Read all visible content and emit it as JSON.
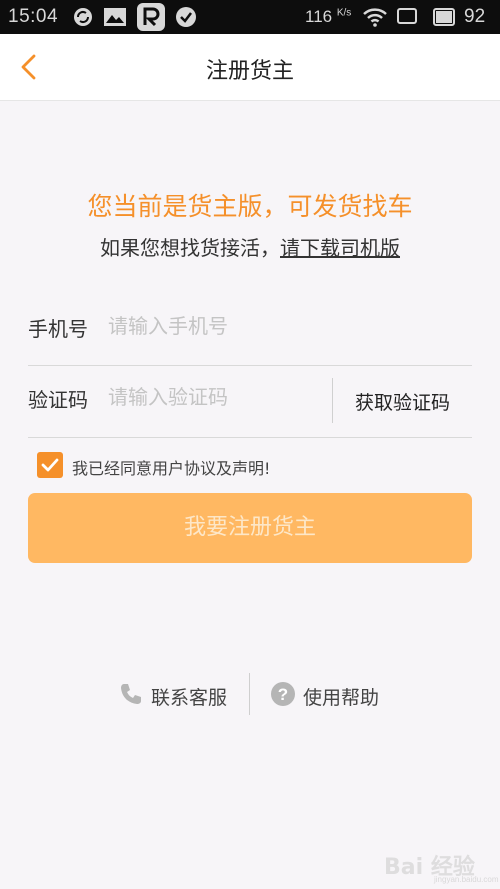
{
  "status_bar": {
    "time": "15:04",
    "network_speed": "116",
    "network_unit": "K/s",
    "battery": "92",
    "icons": [
      "sync-icon",
      "image-icon",
      "r-app-icon",
      "check-circle-icon",
      "wifi-icon",
      "battery-icon"
    ]
  },
  "header": {
    "title": "注册货主",
    "back_icon": "chevron-left-icon"
  },
  "intro": {
    "headline": "您当前是货主版，可发货找车",
    "subline_prefix": "如果您想找货接活，",
    "subline_link": "请下载司机版"
  },
  "form": {
    "phone": {
      "label": "手机号",
      "value": "",
      "placeholder": "请输入手机号"
    },
    "code": {
      "label": "验证码",
      "value": "",
      "placeholder": "请输入验证码"
    },
    "get_code_label": "获取验证码"
  },
  "agreement": {
    "checked": true,
    "text": "我已经同意用户协议及声明!"
  },
  "register_button": {
    "label": "我要注册货主"
  },
  "bottom_links": {
    "contact": {
      "label": "联系客服",
      "icon": "phone-icon"
    },
    "help": {
      "label": "使用帮助",
      "icon": "question-circle-icon"
    }
  },
  "colors": {
    "accent": "#f5902a",
    "button": "#ffb862",
    "background": "#f7f5f8"
  },
  "watermark": {
    "text": "Bai 经验",
    "sub": "jingyan.baidu.com"
  }
}
